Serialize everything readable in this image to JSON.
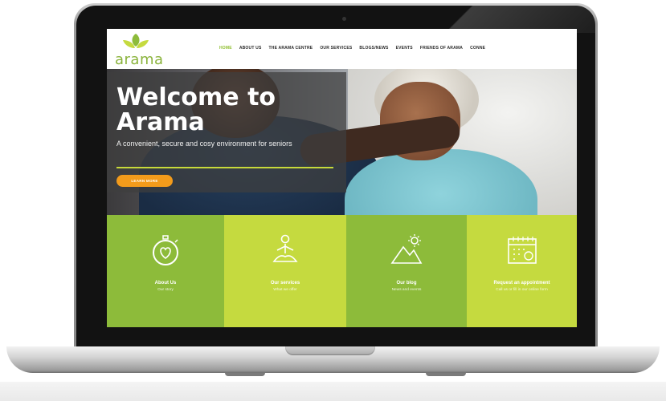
{
  "site": {
    "logo_text": "arama",
    "nav": [
      "HOME",
      "ABOUT US",
      "THE ARAMA CENTRE",
      "OUR SERVICES",
      "BLOGS/NEWS",
      "EVENTS",
      "FRIENDS OF ARAMA",
      "CONNE"
    ],
    "active_nav": 0,
    "hero": {
      "title_line1": "Welcome to",
      "title_line2": "Arama",
      "subtitle": "A convenient, secure and cosy environment for seniors",
      "button": "LEARN MORE"
    },
    "tiles": [
      {
        "title": "About Us",
        "subtitle": "Our story",
        "icon": "heart-stopwatch-icon",
        "color": "#8dbb3a"
      },
      {
        "title": "Our services",
        "subtitle": "What we offer",
        "icon": "meditation-icon",
        "color": "#c5da3f"
      },
      {
        "title": "Our blog",
        "subtitle": "News and events",
        "icon": "mountain-sun-icon",
        "color": "#8dbb3a"
      },
      {
        "title": "Request an appointment",
        "subtitle": "Call us or fill in our online form",
        "icon": "calendar-icon",
        "color": "#c5da3f"
      }
    ]
  },
  "colors": {
    "brand_green": "#8dbb3a",
    "lime": "#c5da3f",
    "button_orange": "#f39b1b",
    "laptop_bezel": "#121212"
  }
}
